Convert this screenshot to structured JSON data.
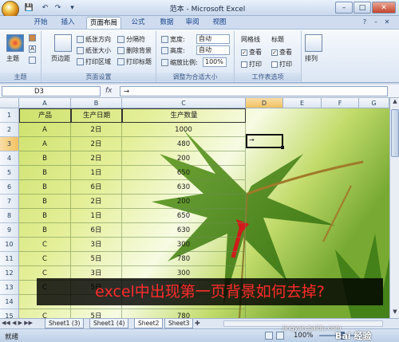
{
  "window": {
    "title": "范本 - Microsoft Excel",
    "min_glyph": "–",
    "max_glyph": "□",
    "close_glyph": "✕",
    "restore_glyph": "–",
    "close_doc_glyph": "✕"
  },
  "qat": {
    "save": "💾",
    "undo": "↶",
    "redo": "↷",
    "more": "▾"
  },
  "tabs": [
    "开始",
    "插入",
    "页面布局",
    "公式",
    "数据",
    "审阅",
    "视图"
  ],
  "active_tab": "页面布局",
  "ribbon": {
    "themes": {
      "big_label": "主题",
      "group_label": "主题"
    },
    "page_setup": {
      "margins": "页边距",
      "orientation": "纸张方向",
      "size": "纸张大小",
      "print_area": "打印区域",
      "breaks": "分隔符",
      "background": "删除背景",
      "print_titles": "打印标题",
      "group_label": "页面设置"
    },
    "scale_to_fit": {
      "width_label": "宽度:",
      "width_value": "自动",
      "height_label": "高度:",
      "height_value": "自动",
      "scale_label": "缩放比例:",
      "scale_value": "100%",
      "group_label": "调整为合适大小"
    },
    "sheet_options": {
      "gridlines": "网格线",
      "headings": "标题",
      "view": "查看",
      "print": "打印",
      "group_label": "工作表选项"
    },
    "arrange": {
      "label": "排列"
    }
  },
  "formula_bar": {
    "name_box": "D3",
    "fx": "fx",
    "content": "→"
  },
  "columns": [
    "A",
    "B",
    "C",
    "D",
    "E",
    "F",
    "G"
  ],
  "selected_column": "D",
  "rows": [
    "1",
    "2",
    "3",
    "4",
    "5",
    "6",
    "7",
    "8",
    "9",
    "10",
    "11",
    "12",
    "13",
    "14",
    "15"
  ],
  "selected_row": "3",
  "table": {
    "headers": [
      "产品",
      "生产日期",
      "生产数量"
    ],
    "data": [
      [
        "A",
        "2日",
        "1000"
      ],
      [
        "A",
        "2日",
        "480"
      ],
      [
        "B",
        "2日",
        "200"
      ],
      [
        "B",
        "1日",
        "650"
      ],
      [
        "B",
        "6日",
        "630"
      ],
      [
        "B",
        "2日",
        "200"
      ],
      [
        "B",
        "1日",
        "650"
      ],
      [
        "B",
        "6日",
        "630"
      ],
      [
        "C",
        "3日",
        "300"
      ],
      [
        "C",
        "5日",
        "780"
      ],
      [
        "C",
        "3日",
        "300"
      ],
      [
        "C",
        "5日",
        "780"
      ],
      [
        "",
        "",
        ""
      ],
      [
        "C",
        "5日",
        "780"
      ]
    ],
    "active_cell_value": "→"
  },
  "caption": "excel中出现第一页背景如何去掉?",
  "sheet_tabs": [
    "Sheet1 (3)",
    "Sheet1 (4)",
    "Sheet2",
    "Sheet3"
  ],
  "active_sheet": "Sheet2",
  "status": {
    "mode": "就绪",
    "zoom": "100%",
    "watermark": "Bai 经验",
    "site": "jingyan.baidu.com"
  }
}
